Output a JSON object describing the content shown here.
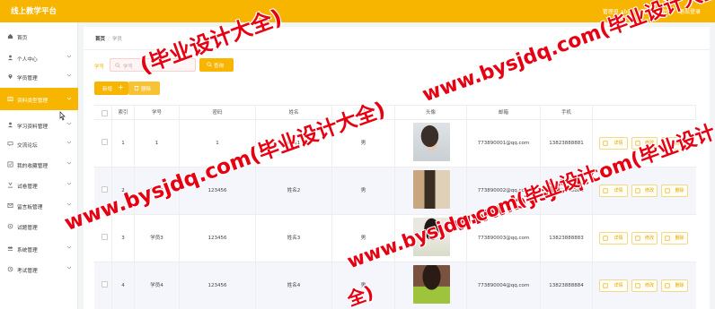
{
  "app": {
    "title": "线上教学平台",
    "user_label": "管理员 abo",
    "exit_label": "退出到前台",
    "logout_label": "退出登录"
  },
  "sidebar": {
    "items": [
      {
        "label": "首页",
        "icon": "home-icon",
        "has_arrow": false
      },
      {
        "label": "个人中心",
        "icon": "user-icon",
        "has_arrow": true
      },
      {
        "label": "学员管理",
        "icon": "location-icon",
        "has_arrow": true
      },
      {
        "label": "资料类型管理",
        "icon": "folder-icon",
        "has_arrow": true,
        "active": true
      },
      {
        "label": "学习资料管理",
        "icon": "user-icon",
        "has_arrow": true
      },
      {
        "label": "交流论坛",
        "icon": "chat-icon",
        "has_arrow": true
      },
      {
        "label": "我的收藏管理",
        "icon": "star-icon",
        "has_arrow": true
      },
      {
        "label": "试卷管理",
        "icon": "paper-icon",
        "has_arrow": true
      },
      {
        "label": "留言板管理",
        "icon": "message-icon",
        "has_arrow": true
      },
      {
        "label": "试题管理",
        "icon": "question-icon",
        "has_arrow": true
      },
      {
        "label": "系统管理",
        "icon": "system-icon",
        "has_arrow": true
      },
      {
        "label": "考试管理",
        "icon": "exam-icon",
        "has_arrow": true
      }
    ]
  },
  "breadcrumb": {
    "home": "首页",
    "current": "学员"
  },
  "search": {
    "label": "学号",
    "placeholder": "学号",
    "button_label": "查询"
  },
  "toolbar": {
    "add_label": "新增",
    "delete_label": "删除"
  },
  "table": {
    "columns": [
      "索引",
      "学号",
      "密码",
      "姓名",
      "性别",
      "头像",
      "邮箱",
      "手机",
      ""
    ],
    "rows": [
      {
        "index": "1",
        "student_id": "1",
        "password": "1",
        "name": "姓名1",
        "gender": "男",
        "email": "773890001@qq.com",
        "phone": "13823888881"
      },
      {
        "index": "2",
        "student_id": "学员2",
        "password": "123456",
        "name": "姓名2",
        "gender": "男",
        "email": "773890002@qq.com",
        "phone": "13823888882"
      },
      {
        "index": "3",
        "student_id": "学员3",
        "password": "123456",
        "name": "姓名3",
        "gender": "男",
        "email": "773890003@qq.com",
        "phone": "13823888883"
      },
      {
        "index": "4",
        "student_id": "学员4",
        "password": "123456",
        "name": "姓名4",
        "gender": "男",
        "email": "773890004@qq.com",
        "phone": "13823888884"
      }
    ],
    "actions": {
      "detail": "详情",
      "edit": "修改",
      "delete": "删除"
    }
  },
  "watermark": {
    "texts": [
      "(毕业设计大全)",
      "www.bysjdq.com(毕业设计大全)",
      "www.bysjdq.com(毕业设计",
      "www.bysjdq.com(毕业设计",
      "www.bysjdq.com(毕业设计大全)",
      "全)"
    ]
  },
  "colors": {
    "accent": "#f7b500",
    "watermark": "#e60012"
  }
}
